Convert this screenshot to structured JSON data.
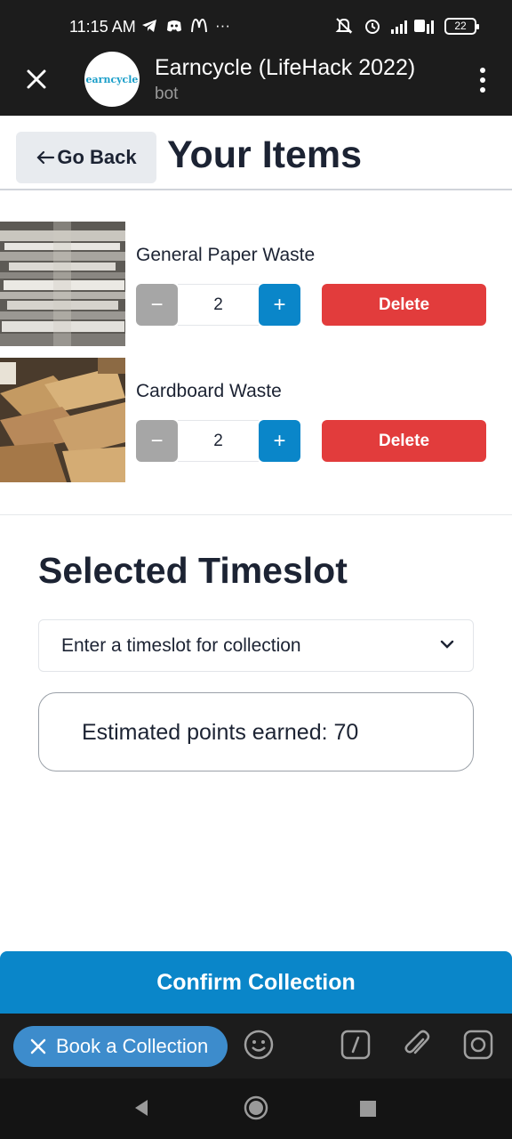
{
  "status_bar": {
    "time": "11:15 AM",
    "extra_icons": "···",
    "battery": "22"
  },
  "app_bar": {
    "title": "Earncycle (LifeHack 2022)",
    "subtitle": "bot",
    "avatar_text": "earncycle"
  },
  "header": {
    "back_label": "Go Back",
    "title": "Your Items"
  },
  "items": [
    {
      "name": "General Paper Waste",
      "quantity": "2",
      "delete_label": "Delete"
    },
    {
      "name": "Cardboard Waste",
      "quantity": "2",
      "delete_label": "Delete"
    }
  ],
  "timeslot": {
    "title": "Selected Timeslot",
    "select_value": "Enter a timeslot for collection",
    "points_text": "Estimated points earned: 70"
  },
  "confirm_label": "Confirm Collection",
  "bottom_bar": {
    "book_label": "Book a Collection"
  },
  "colors": {
    "primary": "#0a86c9",
    "danger": "#e23c3c",
    "neutral_button": "#a6a6a6",
    "dark_bar": "#1c1c1c",
    "telegram_button": "#3d8ccc"
  },
  "icons": [
    "telegram-icon",
    "discord-icon",
    "mcdonalds-icon",
    "mute-icon",
    "alarm-icon",
    "signal-icon",
    "close-icon",
    "more-vert-icon",
    "arrow-left-icon",
    "chevron-down-icon",
    "emoji-icon",
    "command-icon",
    "attach-icon",
    "camera-icon",
    "back-nav-icon",
    "home-nav-icon",
    "recents-nav-icon"
  ]
}
